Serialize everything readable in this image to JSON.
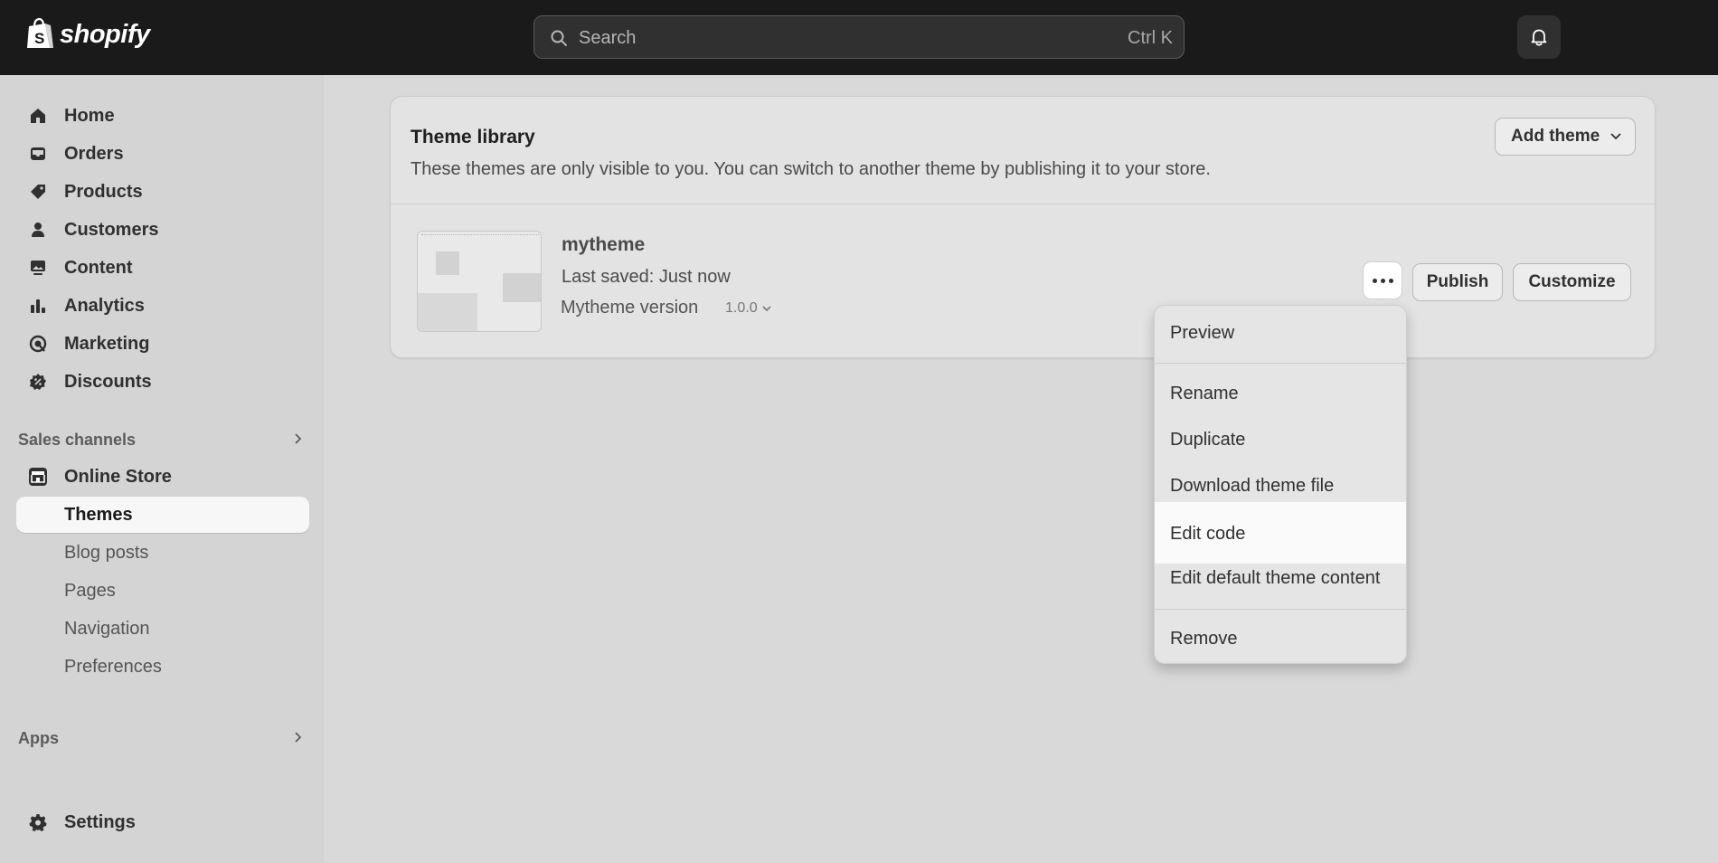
{
  "topbar": {
    "logo_text": "shopify",
    "search": {
      "placeholder": "Search",
      "shortcut": "Ctrl K"
    },
    "notifications_icon": "bell-icon"
  },
  "sidebar": {
    "items": [
      {
        "label": "Home",
        "icon": "home-icon"
      },
      {
        "label": "Orders",
        "icon": "inbox-icon"
      },
      {
        "label": "Products",
        "icon": "tag-icon"
      },
      {
        "label": "Customers",
        "icon": "person-icon"
      },
      {
        "label": "Content",
        "icon": "image-icon"
      },
      {
        "label": "Analytics",
        "icon": "bar-chart-icon"
      },
      {
        "label": "Marketing",
        "icon": "target-icon"
      },
      {
        "label": "Discounts",
        "icon": "discount-icon"
      }
    ],
    "sales_channels": {
      "heading": "Sales channels",
      "online_store": {
        "label": "Online Store",
        "icon": "store-icon"
      },
      "sub_items": [
        {
          "label": "Themes",
          "active": true
        },
        {
          "label": "Blog posts"
        },
        {
          "label": "Pages"
        },
        {
          "label": "Navigation"
        },
        {
          "label": "Preferences"
        }
      ]
    },
    "apps": {
      "heading": "Apps"
    },
    "settings": {
      "label": "Settings",
      "icon": "gear-icon"
    }
  },
  "theme_library": {
    "title": "Theme library",
    "description": "These themes are only visible to you. You can switch to another theme by publishing it to your store.",
    "add_theme_label": "Add theme",
    "theme": {
      "name": "mytheme",
      "last_saved": "Last saved: Just now",
      "version_label": "Mytheme version",
      "version": "1.0.0"
    },
    "publish_label": "Publish",
    "customize_label": "Customize"
  },
  "menu": {
    "items": [
      {
        "label": "Preview"
      },
      {
        "label": "Rename"
      },
      {
        "label": "Duplicate"
      },
      {
        "label": "Download theme file"
      },
      {
        "label": "Edit code",
        "highlighted": true
      },
      {
        "label": "Edit default theme content"
      },
      {
        "label": "Remove"
      }
    ]
  },
  "colors": {
    "topbar": "#1a1a1a",
    "background": "#d9d9d9",
    "card": "#e3e3e3",
    "menu_highlight": "#fafafa"
  }
}
